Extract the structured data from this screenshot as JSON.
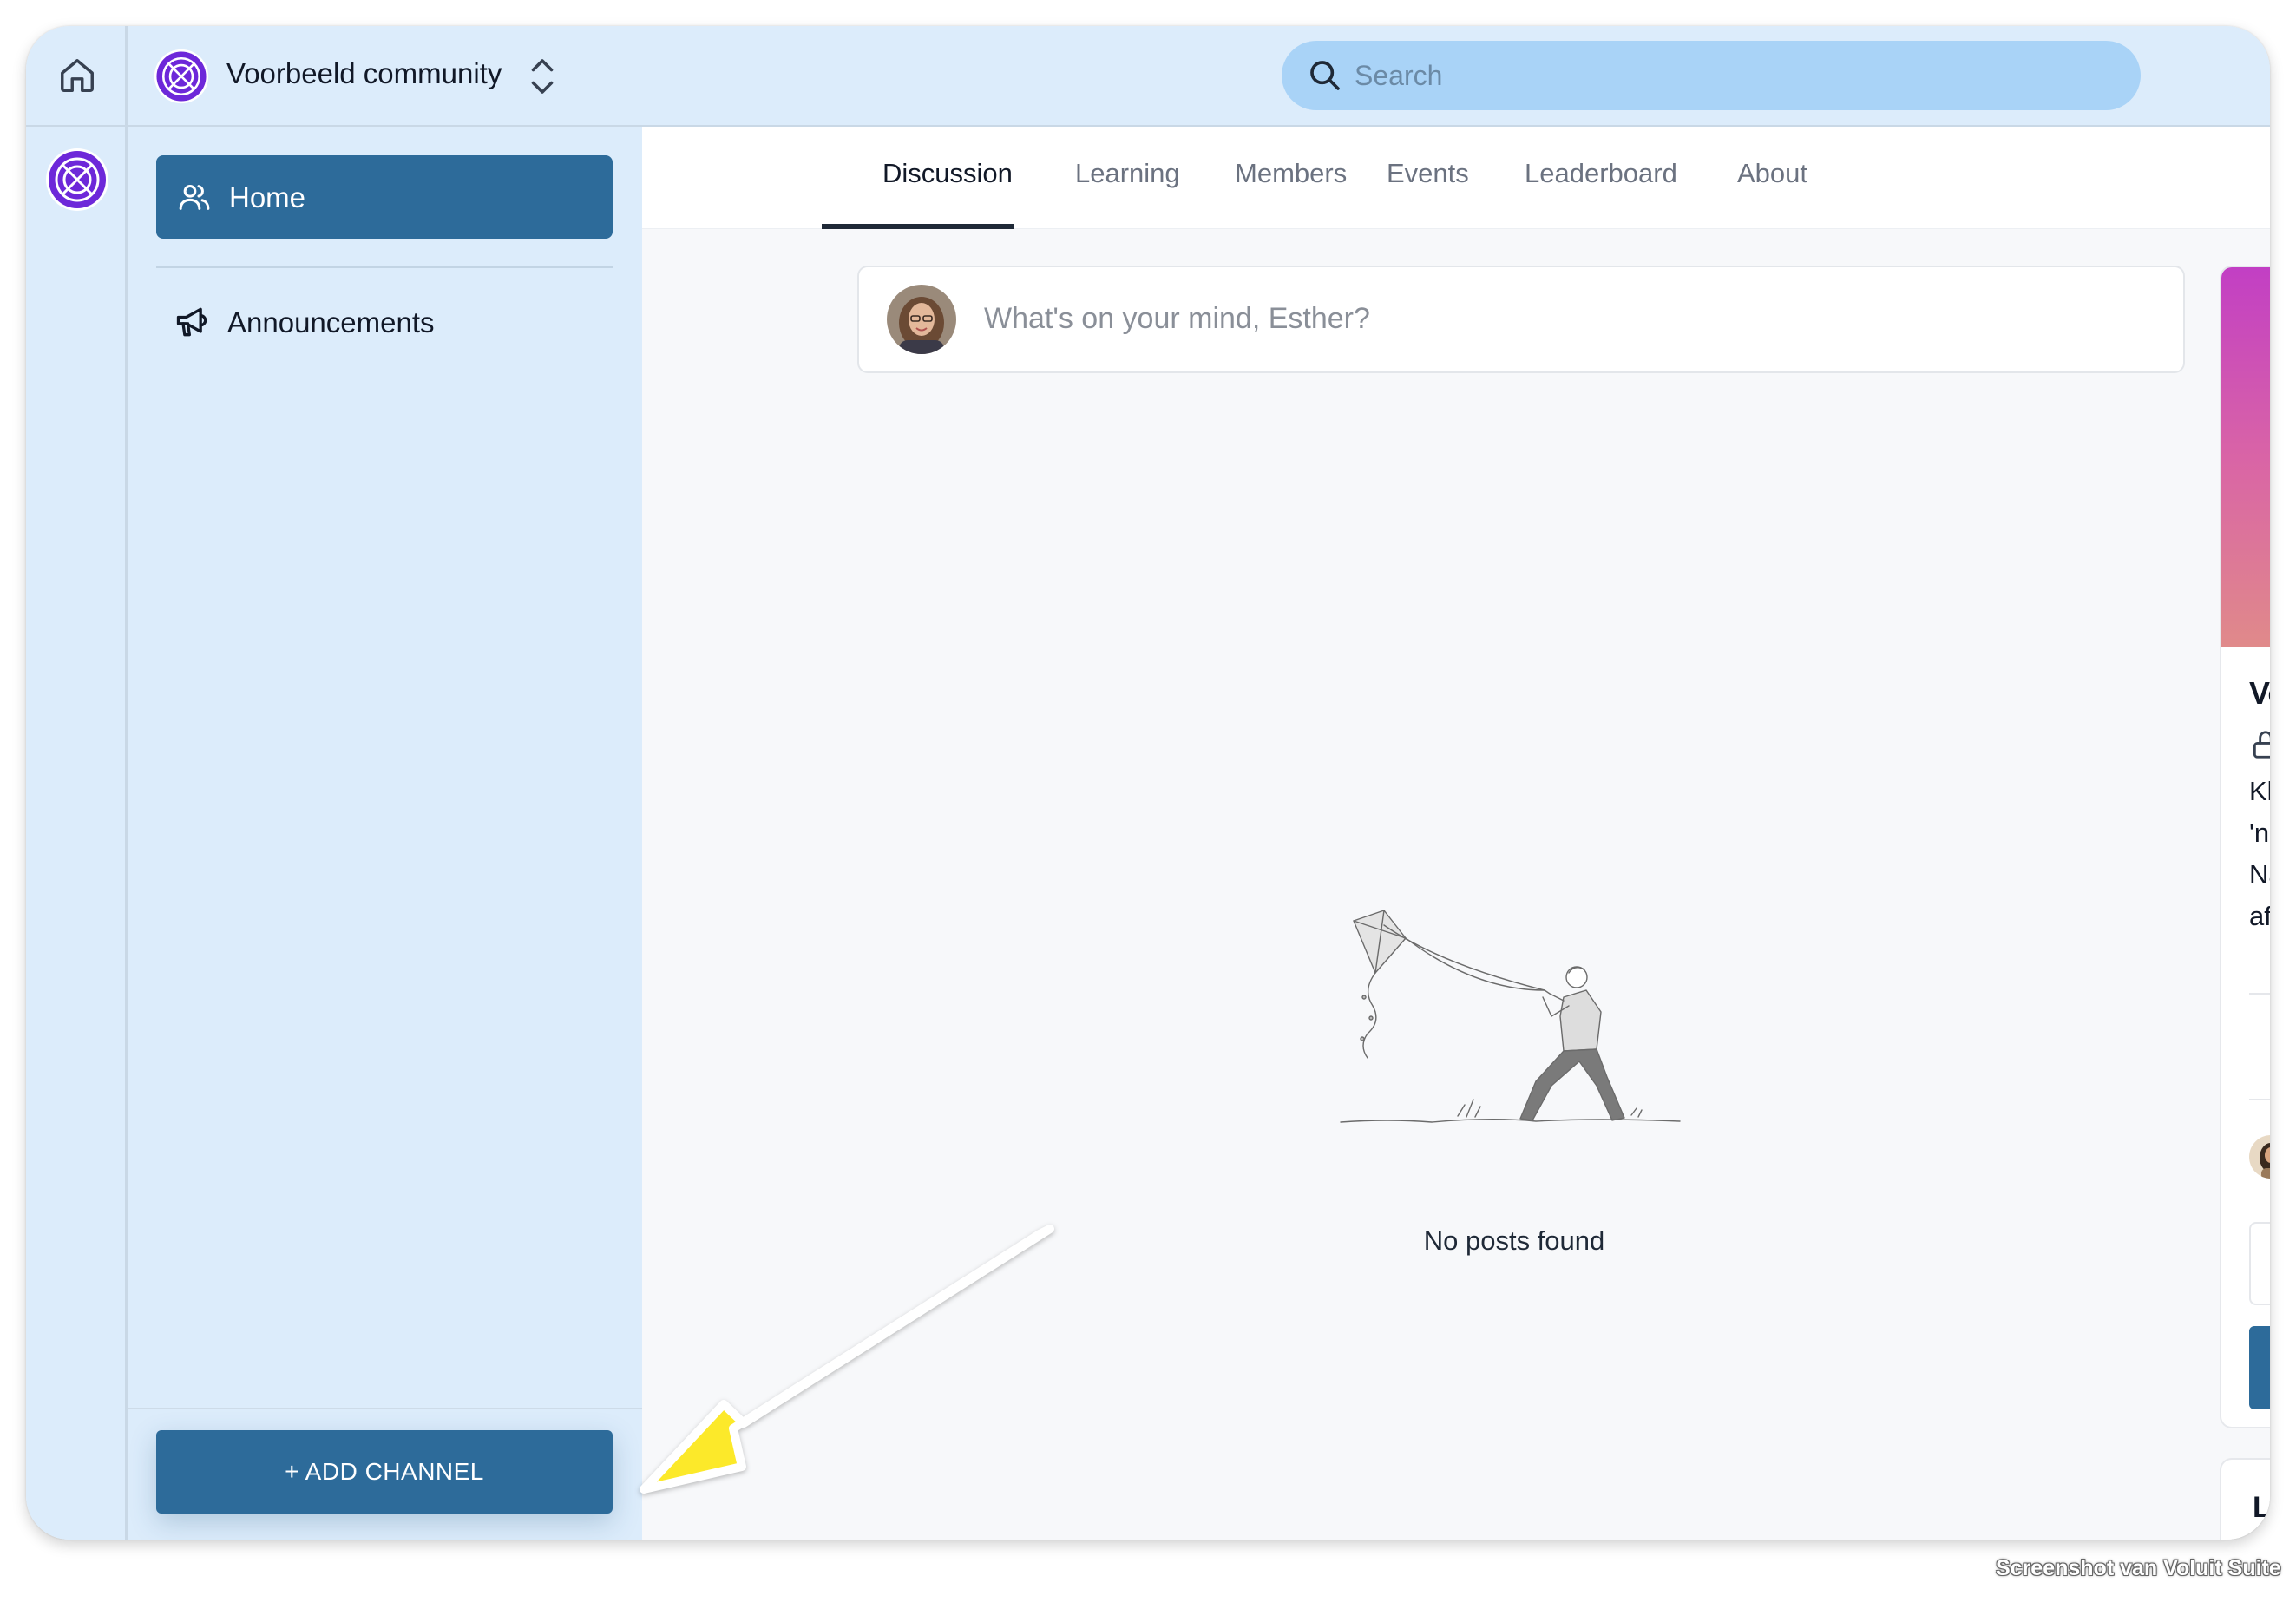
{
  "topbar": {
    "community_name": "Voorbeeld community",
    "search_placeholder": "Search"
  },
  "sidebar": {
    "items": [
      {
        "label": "Home",
        "icon": "users-icon",
        "active": true
      },
      {
        "label": "Announcements",
        "icon": "megaphone-icon",
        "active": false
      }
    ],
    "add_channel_label": "+ ADD CHANNEL"
  },
  "tabs": [
    {
      "label": "Discussion",
      "active": true
    },
    {
      "label": "Learning"
    },
    {
      "label": "Members"
    },
    {
      "label": "Events"
    },
    {
      "label": "Leaderboard"
    },
    {
      "label": "About"
    }
  ],
  "composer": {
    "placeholder": "What's on your mind, Esther?"
  },
  "feed": {
    "empty_text": "No posts found"
  },
  "right_card": {
    "title_partial": "Voc",
    "lines_partial": [
      "Klik",
      "'new",
      "Na l",
      "afsc"
    ]
  },
  "right_card_2": {
    "title_partial": "Lea"
  },
  "watermark": "Screenshot van Voluit Suite",
  "colors": {
    "accent": "#2d6b9a",
    "sidebar_bg": "#dcecfb",
    "search_bg": "#a9d3f7",
    "brand_purple": "#6d28d9",
    "annotation_arrow": "#fce92a"
  }
}
